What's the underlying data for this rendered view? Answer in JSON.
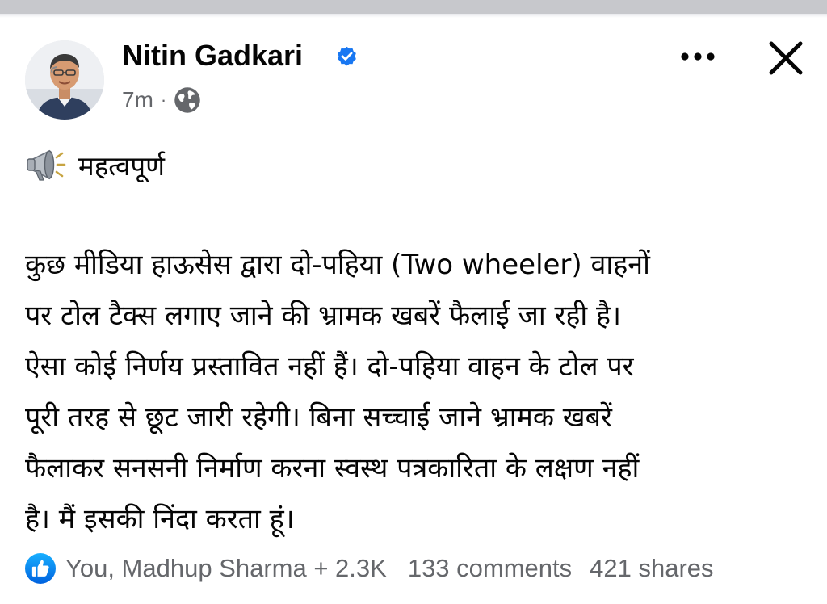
{
  "post": {
    "author": "Nitin Gadkari",
    "verified": true,
    "time": "7m",
    "separator": "·",
    "audience_icon": "globe-icon",
    "headline_icon": "megaphone-icon",
    "headline": "महत्वपूर्ण",
    "body": "कुछ मीडिया हाऊसेस  द्वारा दो-पहिया (Two wheeler) वाहनों\nपर टोल टैक्स लगाए जाने की भ्रामक खबरें फैलाई जा रही है।\nऐसा कोई निर्णय प्रस्तावित नहीं हैं। दो-पहिया वाहन के टोल पर\nपूरी तरह से छूट जारी रहेगी। बिना सच्चाई जाने भ्रामक खबरें\nफैलाकर सनसनी निर्माण करना स्वस्थ पत्रकारिता के लक्षण नहीं\nहै। मैं इसकी निंदा करता हूं।"
  },
  "reactions": {
    "icon": "like-icon",
    "reactors": "You, Madhup Sharma + 2.3K",
    "comments": "133 comments",
    "shares": "421 shares"
  },
  "colors": {
    "primary_text": "#050505",
    "secondary_text": "#65676b",
    "brand_blue": "#1877f2",
    "top_strip": "#c7c8cc"
  }
}
